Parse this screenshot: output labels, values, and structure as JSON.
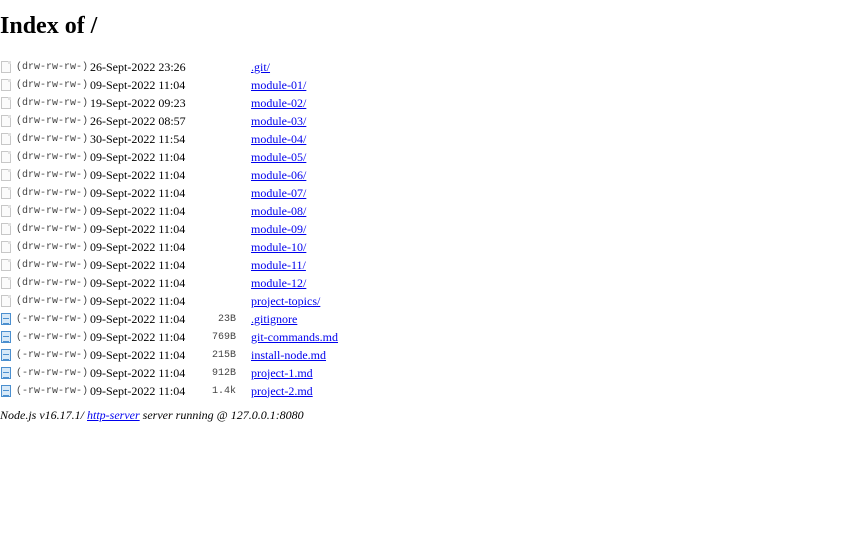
{
  "page": {
    "title": "Index of /"
  },
  "entries": [
    {
      "type": "dir",
      "perms": "(drw-rw-rw-)",
      "date": "26-Sept-2022 23:26",
      "size": "",
      "name": ".git/"
    },
    {
      "type": "dir",
      "perms": "(drw-rw-rw-)",
      "date": "09-Sept-2022 11:04",
      "size": "",
      "name": "module-01/"
    },
    {
      "type": "dir",
      "perms": "(drw-rw-rw-)",
      "date": "19-Sept-2022 09:23",
      "size": "",
      "name": "module-02/"
    },
    {
      "type": "dir",
      "perms": "(drw-rw-rw-)",
      "date": "26-Sept-2022 08:57",
      "size": "",
      "name": "module-03/"
    },
    {
      "type": "dir",
      "perms": "(drw-rw-rw-)",
      "date": "30-Sept-2022 11:54",
      "size": "",
      "name": "module-04/"
    },
    {
      "type": "dir",
      "perms": "(drw-rw-rw-)",
      "date": "09-Sept-2022 11:04",
      "size": "",
      "name": "module-05/"
    },
    {
      "type": "dir",
      "perms": "(drw-rw-rw-)",
      "date": "09-Sept-2022 11:04",
      "size": "",
      "name": "module-06/"
    },
    {
      "type": "dir",
      "perms": "(drw-rw-rw-)",
      "date": "09-Sept-2022 11:04",
      "size": "",
      "name": "module-07/"
    },
    {
      "type": "dir",
      "perms": "(drw-rw-rw-)",
      "date": "09-Sept-2022 11:04",
      "size": "",
      "name": "module-08/"
    },
    {
      "type": "dir",
      "perms": "(drw-rw-rw-)",
      "date": "09-Sept-2022 11:04",
      "size": "",
      "name": "module-09/"
    },
    {
      "type": "dir",
      "perms": "(drw-rw-rw-)",
      "date": "09-Sept-2022 11:04",
      "size": "",
      "name": "module-10/"
    },
    {
      "type": "dir",
      "perms": "(drw-rw-rw-)",
      "date": "09-Sept-2022 11:04",
      "size": "",
      "name": "module-11/"
    },
    {
      "type": "dir",
      "perms": "(drw-rw-rw-)",
      "date": "09-Sept-2022 11:04",
      "size": "",
      "name": "module-12/"
    },
    {
      "type": "dir",
      "perms": "(drw-rw-rw-)",
      "date": "09-Sept-2022 11:04",
      "size": "",
      "name": "project-topics/"
    },
    {
      "type": "file",
      "perms": "(-rw-rw-rw-)",
      "date": "09-Sept-2022 11:04",
      "size": "23B",
      "name": ".gitignore"
    },
    {
      "type": "file",
      "perms": "(-rw-rw-rw-)",
      "date": "09-Sept-2022 11:04",
      "size": "769B",
      "name": "git-commands.md"
    },
    {
      "type": "file",
      "perms": "(-rw-rw-rw-)",
      "date": "09-Sept-2022 11:04",
      "size": "215B",
      "name": "install-node.md"
    },
    {
      "type": "file",
      "perms": "(-rw-rw-rw-)",
      "date": "09-Sept-2022 11:04",
      "size": "912B",
      "name": "project-1.md"
    },
    {
      "type": "file",
      "perms": "(-rw-rw-rw-)",
      "date": "09-Sept-2022 11:04",
      "size": "1.4k",
      "name": "project-2.md"
    }
  ],
  "footer": {
    "prefix": "Node.js v16.17.1/ ",
    "link_text": "http-server",
    "suffix": " server running @ 127.0.0.1:8080"
  },
  "icons": {
    "dir": "folder-icon",
    "file": "file-icon"
  },
  "colors": {
    "link": "#0000ee",
    "meta_text": "#444444",
    "file_icon": "#4b8fcf"
  }
}
